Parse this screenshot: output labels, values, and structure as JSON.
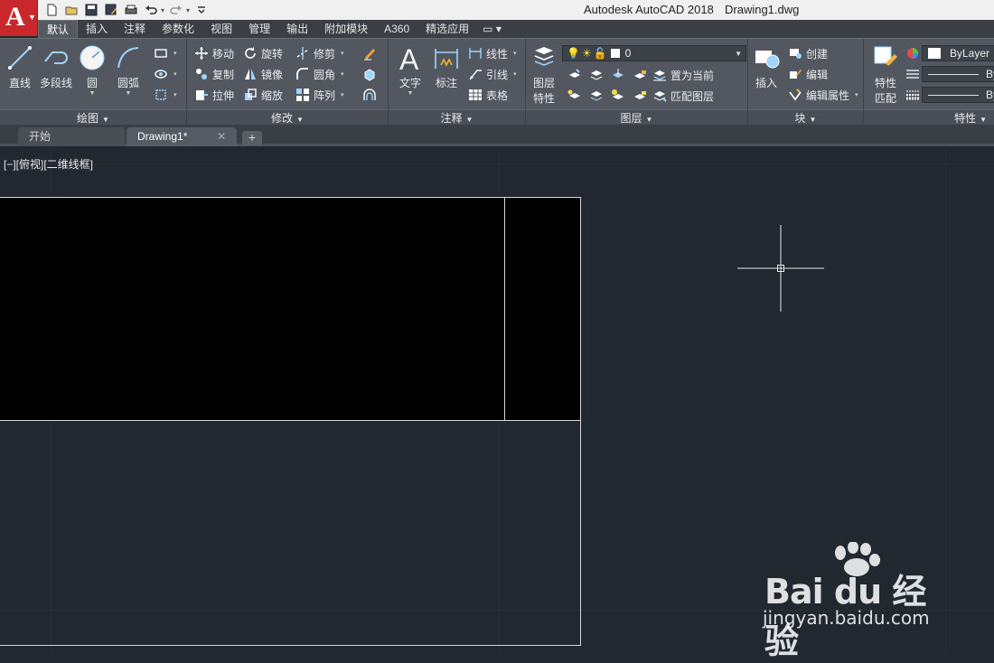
{
  "titlebar": {
    "app_title": "Autodesk AutoCAD 2018",
    "document_title": "Drawing1.dwg",
    "logo_letter": "A"
  },
  "ribbon_tabs": [
    "默认",
    "插入",
    "注释",
    "参数化",
    "视图",
    "管理",
    "输出",
    "附加模块",
    "A360",
    "精选应用"
  ],
  "active_tab": "默认",
  "panels": {
    "draw": {
      "title": "绘图",
      "buttons": [
        "直线",
        "多段线",
        "圆",
        "圆弧"
      ]
    },
    "modify": {
      "title": "修改",
      "items": [
        "移动",
        "旋转",
        "修剪",
        "复制",
        "镜像",
        "圆角",
        "拉伸",
        "缩放",
        "阵列"
      ]
    },
    "annotation": {
      "title": "注释",
      "big": [
        "文字",
        "标注"
      ],
      "items": [
        "线性",
        "引线",
        "表格"
      ]
    },
    "layers": {
      "title": "图层",
      "big_top": "图层",
      "big_bottom": "特性",
      "current_layer": "0",
      "items": [
        "置为当前",
        "匹配图层"
      ]
    },
    "block": {
      "title": "块",
      "big": "插入",
      "items": [
        "创建",
        "编辑",
        "编辑属性"
      ]
    },
    "properties": {
      "title": "特性",
      "big_top": "特性",
      "big_bottom": "匹配",
      "color_value": "ByLayer",
      "linetype_value": "By",
      "lineweight_value": "By"
    }
  },
  "doc_tabs": [
    {
      "label": "开始",
      "active": false
    },
    {
      "label": "Drawing1*",
      "active": true
    }
  ],
  "doc_tab_close": "✕",
  "new_tab": "+",
  "viewport_label": "[−][俯视][二维线框]",
  "watermark": {
    "brand": "Bai du 经验",
    "url": "jingyan.baidu.com"
  },
  "colors": {
    "canvas": "#212830",
    "ribbon": "#525760",
    "accent_red": "#c8282c"
  }
}
